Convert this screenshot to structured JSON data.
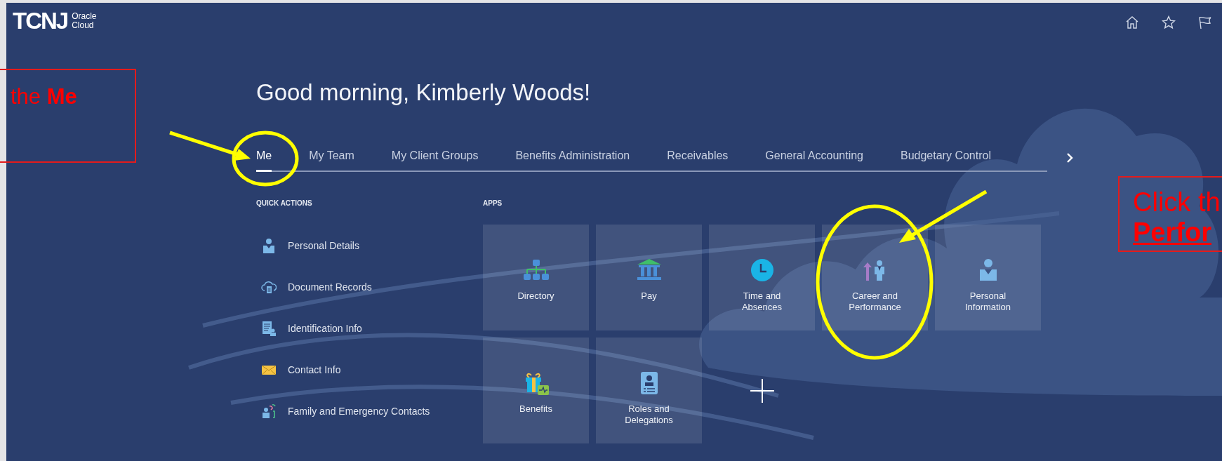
{
  "header": {
    "logo_mark": "TCNJ",
    "logo_lines": [
      "Oracle",
      "Cloud"
    ]
  },
  "greeting": "Good morning, Kimberly Woods!",
  "tabs": [
    {
      "label": "Me",
      "selected": true
    },
    {
      "label": "My Team",
      "selected": false
    },
    {
      "label": "My Client Groups",
      "selected": false
    },
    {
      "label": "Benefits Administration",
      "selected": false
    },
    {
      "label": "Receivables",
      "selected": false
    },
    {
      "label": "General Accounting",
      "selected": false
    },
    {
      "label": "Budgetary Control",
      "selected": false
    }
  ],
  "quick_actions": {
    "heading": "QUICK ACTIONS",
    "items": [
      {
        "label": "Personal Details"
      },
      {
        "label": "Document Records"
      },
      {
        "label": "Identification Info"
      },
      {
        "label": "Contact Info"
      },
      {
        "label": "Family and Emergency Contacts"
      }
    ]
  },
  "apps": {
    "heading": "APPS",
    "tiles": [
      {
        "kind": "app",
        "label": "Directory"
      },
      {
        "kind": "app",
        "label": "Pay"
      },
      {
        "kind": "app",
        "label": "Time and Absences"
      },
      {
        "kind": "app",
        "label": "Career and Performance"
      },
      {
        "kind": "app",
        "label": "Personal Information"
      },
      {
        "kind": "app",
        "label": "Benefits"
      },
      {
        "kind": "app",
        "label": "Roles and Delegations"
      },
      {
        "kind": "add"
      }
    ]
  },
  "callouts": [
    {
      "lines": [
        {
          "text": "the **Me**",
          "emphasis": false
        }
      ]
    },
    {
      "lines": [
        {
          "text": "Click th",
          "emphasis": false
        },
        {
          "text": "Perfor",
          "emphasis": true
        }
      ]
    }
  ]
}
